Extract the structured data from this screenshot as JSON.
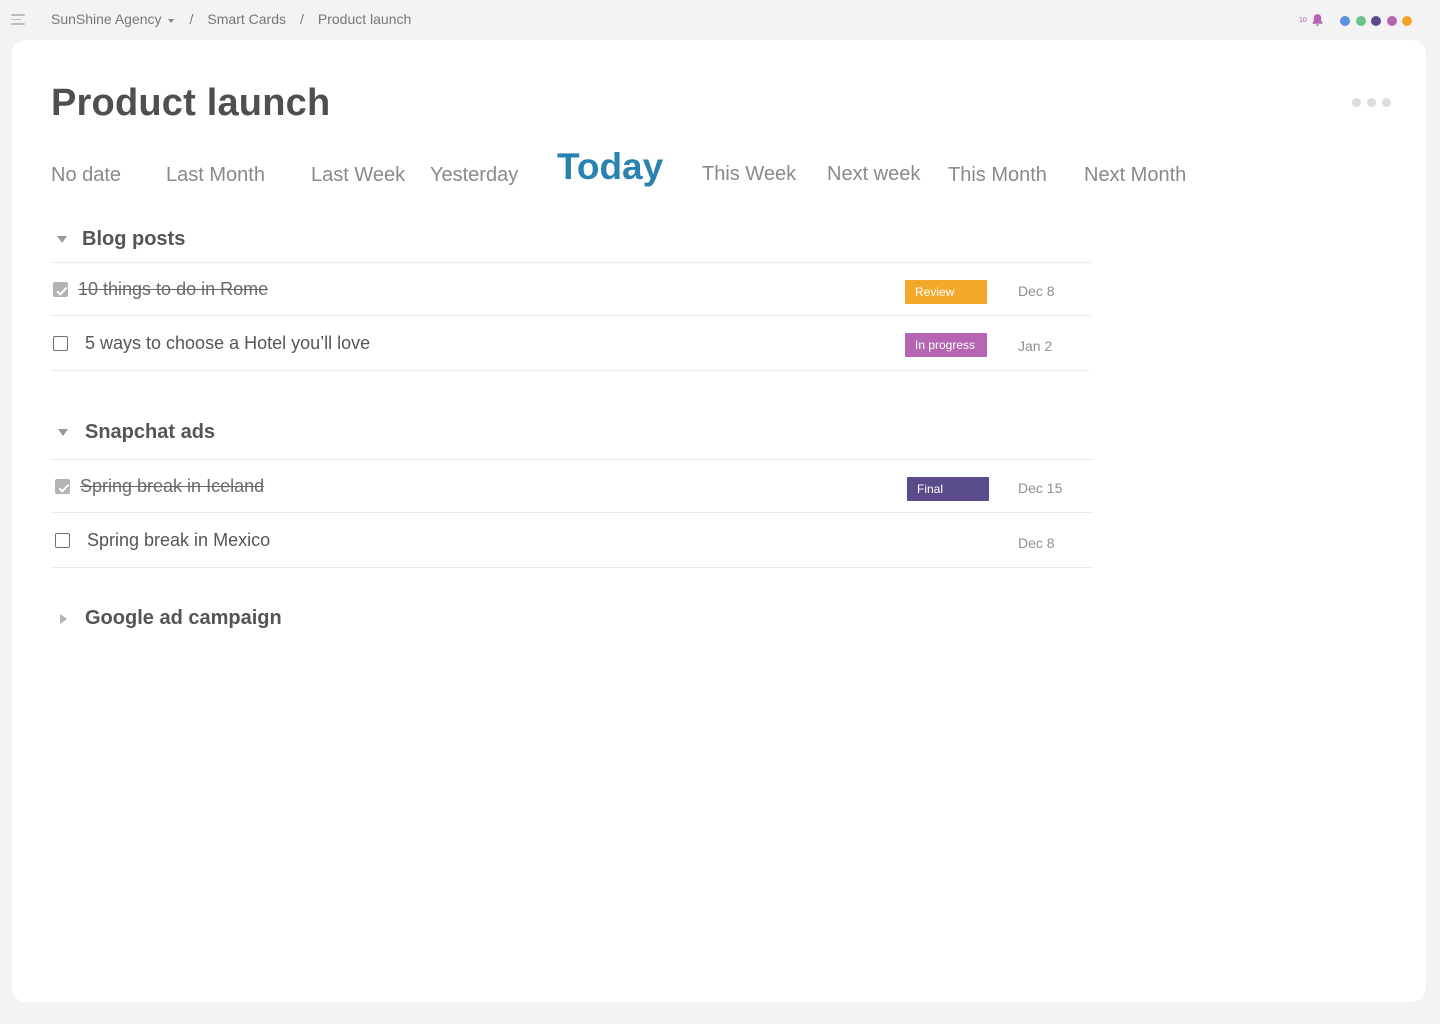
{
  "breadcrumb": {
    "workspace": "SunShine Agency",
    "section": "Smart Cards",
    "page": "Product launch",
    "separator": "/"
  },
  "notifications": {
    "count": "10",
    "icon": "bell-icon",
    "color": "#b565b1"
  },
  "users": [
    {
      "color": "#5b8fd6"
    },
    {
      "color": "#6cc38a"
    },
    {
      "color": "#5b4b8a"
    },
    {
      "color": "#b565b1"
    },
    {
      "color": "#f2a42a"
    }
  ],
  "page": {
    "title": "Product launch"
  },
  "timeline_tabs": [
    {
      "label": "No date",
      "active": false
    },
    {
      "label": "Last Month",
      "active": false
    },
    {
      "label": "Last Week",
      "active": false
    },
    {
      "label": "Yesterday",
      "active": false
    },
    {
      "label": "Today",
      "active": true
    },
    {
      "label": "This Week",
      "active": false
    },
    {
      "label": "Next week",
      "active": false
    },
    {
      "label": "This Month",
      "active": false
    },
    {
      "label": "Next Month",
      "active": false
    }
  ],
  "sections": [
    {
      "title": "Blog posts",
      "expanded": true,
      "tasks": [
        {
          "title": "10 things to do in Rome",
          "done": true,
          "status": "Review",
          "status_color": "#f2a929",
          "due": "Dec 8"
        },
        {
          "title": "5 ways to choose a Hotel you’ll love",
          "done": false,
          "status": "In progress",
          "status_color": "#b565b1",
          "due": "Jan 2"
        }
      ]
    },
    {
      "title": "Snapchat ads",
      "expanded": true,
      "tasks": [
        {
          "title": "Spring break in Iceland",
          "done": true,
          "status": "Final",
          "status_color": "#5b4b8a",
          "due": "Dec 15"
        },
        {
          "title": "Spring break in Mexico",
          "done": false,
          "status": "",
          "status_color": "",
          "due": "Dec 8"
        }
      ]
    },
    {
      "title": "Google ad campaign",
      "expanded": false,
      "tasks": []
    }
  ]
}
